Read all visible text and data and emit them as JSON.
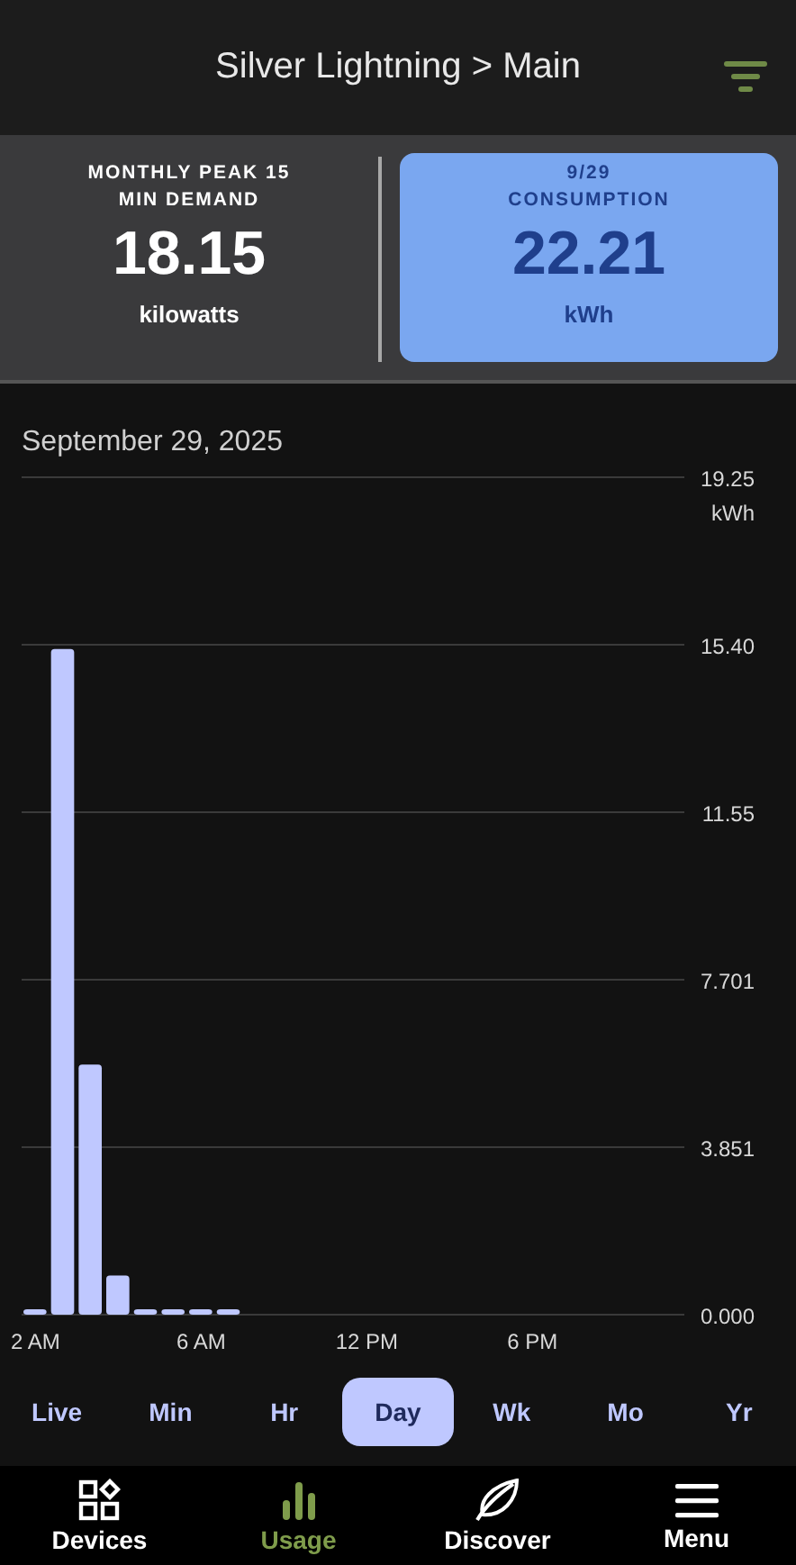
{
  "header": {
    "title": "Silver Lightning > Main"
  },
  "cards": [
    {
      "label_lines": [
        "MONTHLY PEAK 15",
        "MIN DEMAND"
      ],
      "value": "18.15",
      "unit": "kilowatts",
      "selected": false
    },
    {
      "label_lines": [
        "9/29",
        "CONSUMPTION"
      ],
      "value": "22.21",
      "unit": "kWh",
      "selected": true
    }
  ],
  "date": "September 29, 2025",
  "chart_data": {
    "type": "bar",
    "ylabel": "kWh",
    "categories": [
      "2 AM",
      null,
      null,
      null,
      null,
      null,
      "6 AM",
      null,
      null,
      null,
      null,
      null,
      "12 PM",
      null,
      null,
      null,
      null,
      null,
      "6 PM",
      null,
      null,
      null,
      null,
      null
    ],
    "values": [
      0.08,
      15.3,
      5.75,
      0.9,
      0.06,
      0.06,
      0.06,
      0.06,
      null,
      null,
      null,
      null,
      null,
      null,
      null,
      null,
      null,
      null,
      null,
      null,
      null,
      null,
      null,
      null
    ],
    "ylim": [
      0,
      19.25
    ],
    "grid": true,
    "yticks": [
      {
        "value": 0,
        "label": "0.000"
      },
      {
        "value": 3.851,
        "label": "3.851"
      },
      {
        "value": 7.701,
        "label": "7.701"
      },
      {
        "value": 11.55,
        "label": "11.55"
      },
      {
        "value": 15.4,
        "label": "15.40"
      },
      {
        "value": 19.25,
        "label": "19.25"
      }
    ]
  },
  "periods": [
    {
      "label": "Live",
      "selected": false
    },
    {
      "label": "Min",
      "selected": false
    },
    {
      "label": "Hr",
      "selected": false
    },
    {
      "label": "Day",
      "selected": true
    },
    {
      "label": "Wk",
      "selected": false
    },
    {
      "label": "Mo",
      "selected": false
    },
    {
      "label": "Yr",
      "selected": false
    }
  ],
  "nav": [
    {
      "kind": "devices",
      "label": "Devices",
      "selected": false
    },
    {
      "kind": "usage",
      "label": "Usage",
      "selected": true
    },
    {
      "kind": "discover",
      "label": "Discover",
      "selected": false
    },
    {
      "kind": "menu",
      "label": "Menu",
      "selected": false
    }
  ]
}
